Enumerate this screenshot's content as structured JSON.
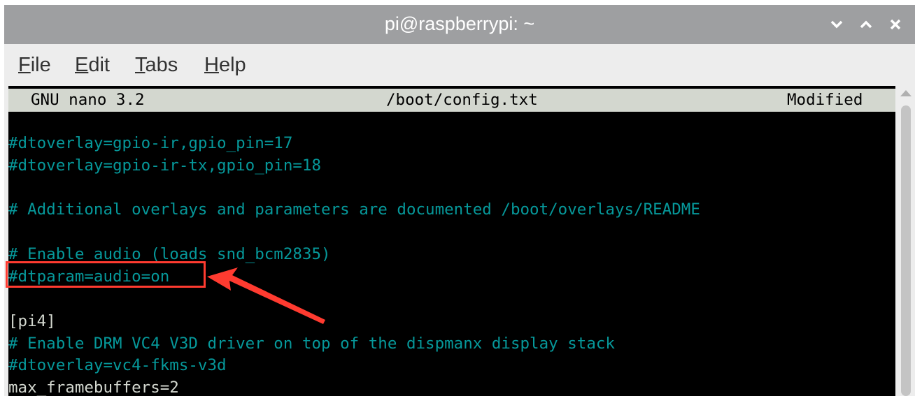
{
  "window": {
    "title": "pi@raspberrypi: ~",
    "minimize_glyph": "⌄",
    "maximize_glyph": "⌃",
    "close_glyph": "✕"
  },
  "menu": [
    {
      "underline": "F",
      "rest": "ile"
    },
    {
      "underline": "E",
      "rest": "dit"
    },
    {
      "underline": "T",
      "rest": "abs"
    },
    {
      "underline": "H",
      "rest": "elp"
    }
  ],
  "nano": {
    "version": "GNU nano 3.2",
    "filename": "/boot/config.txt",
    "status": "Modified"
  },
  "lines": [
    "#dtoverlay=gpio-ir,gpio_pin=17",
    "#dtoverlay=gpio-ir-tx,gpio_pin=18",
    "",
    "# Additional overlays and parameters are documented /boot/overlays/README",
    "",
    "# Enable audio (loads snd_bcm2835)",
    "#dtparam=audio=on",
    "",
    "[pi4]",
    "# Enable DRM VC4 V3D driver on top of the dispmanx display stack",
    "#dtoverlay=vc4-fkms-v3d",
    "max_framebuffers=2"
  ],
  "colors": {
    "terminal_bg": "#000000",
    "comment": "#06989a",
    "plain": "#d3d7cf",
    "annotation": "#ff3b30"
  }
}
